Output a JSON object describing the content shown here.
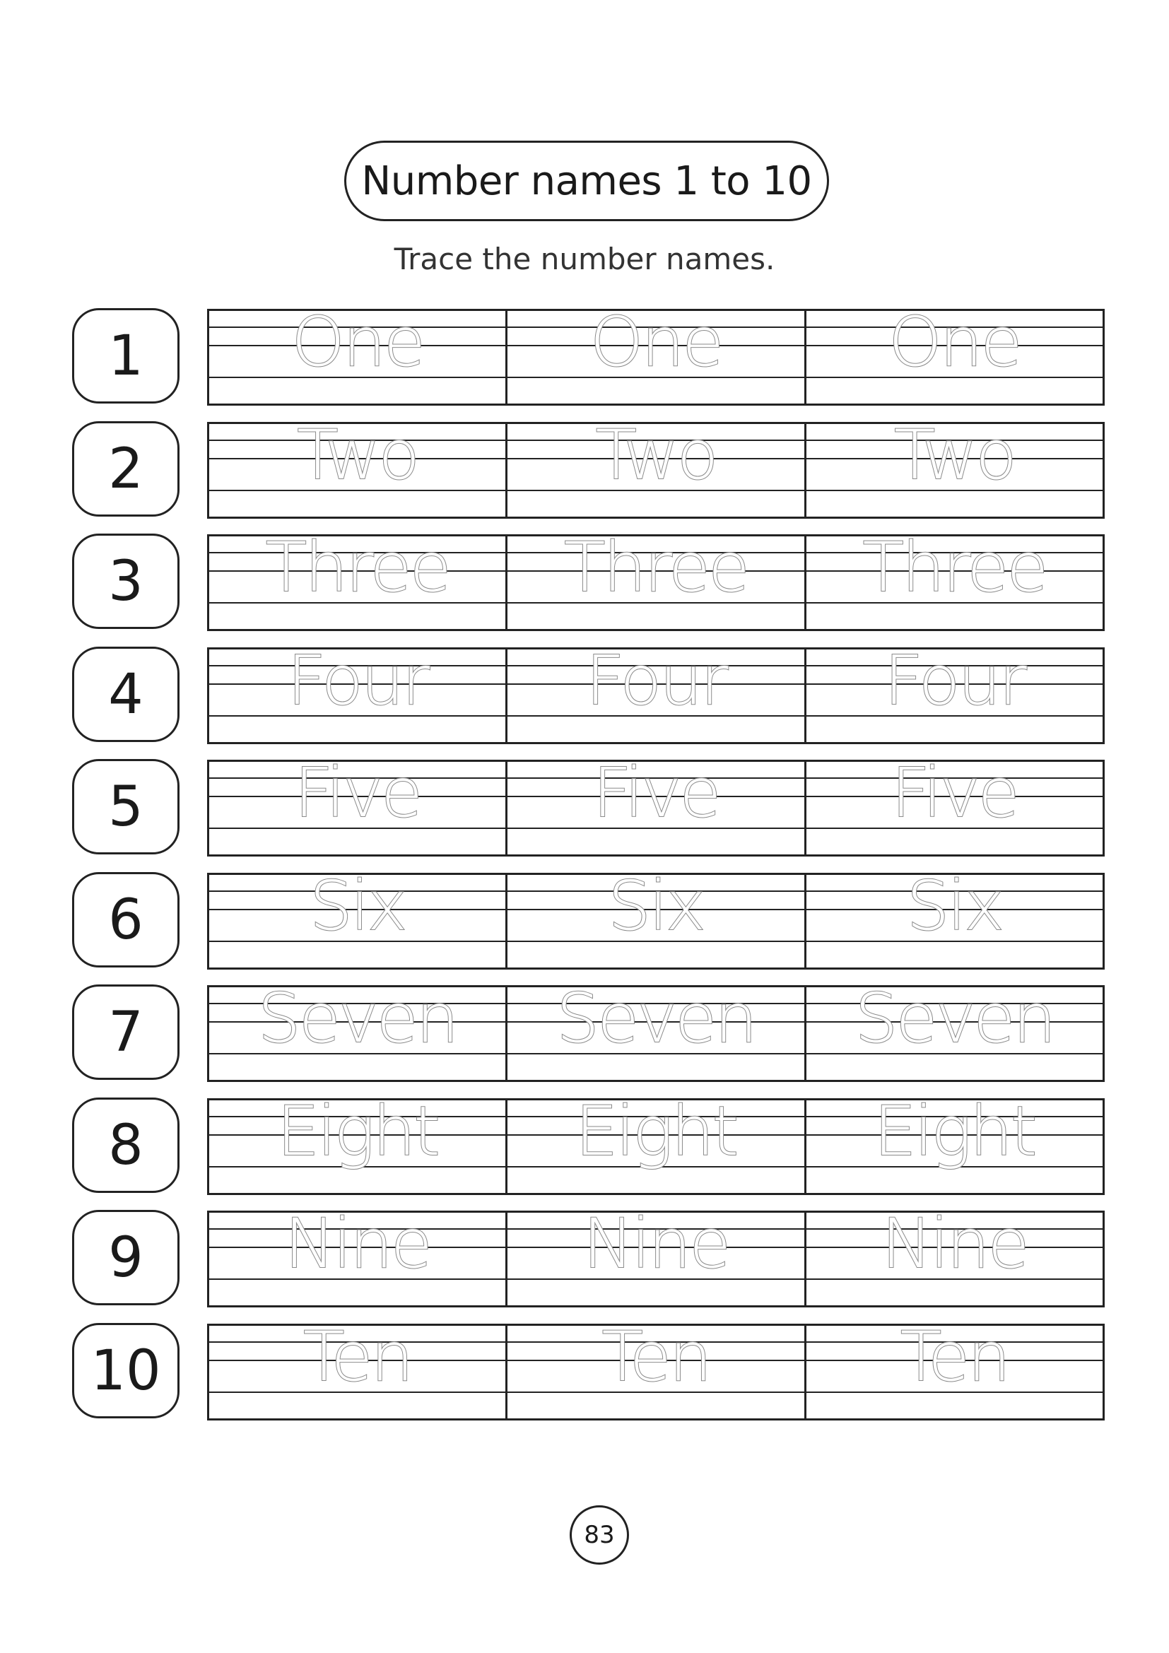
{
  "header": {
    "title": "Number names 1 to 10",
    "instruction": "Trace the number names."
  },
  "rows": [
    {
      "numeral": "1",
      "word": "One"
    },
    {
      "numeral": "2",
      "word": "Two"
    },
    {
      "numeral": "3",
      "word": "Three"
    },
    {
      "numeral": "4",
      "word": "Four"
    },
    {
      "numeral": "5",
      "word": "Five"
    },
    {
      "numeral": "6",
      "word": "Six"
    },
    {
      "numeral": "7",
      "word": "Seven"
    },
    {
      "numeral": "8",
      "word": "Eight"
    },
    {
      "numeral": "9",
      "word": "Nine"
    },
    {
      "numeral": "10",
      "word": "Ten"
    }
  ],
  "footer": {
    "page_number": "83"
  }
}
